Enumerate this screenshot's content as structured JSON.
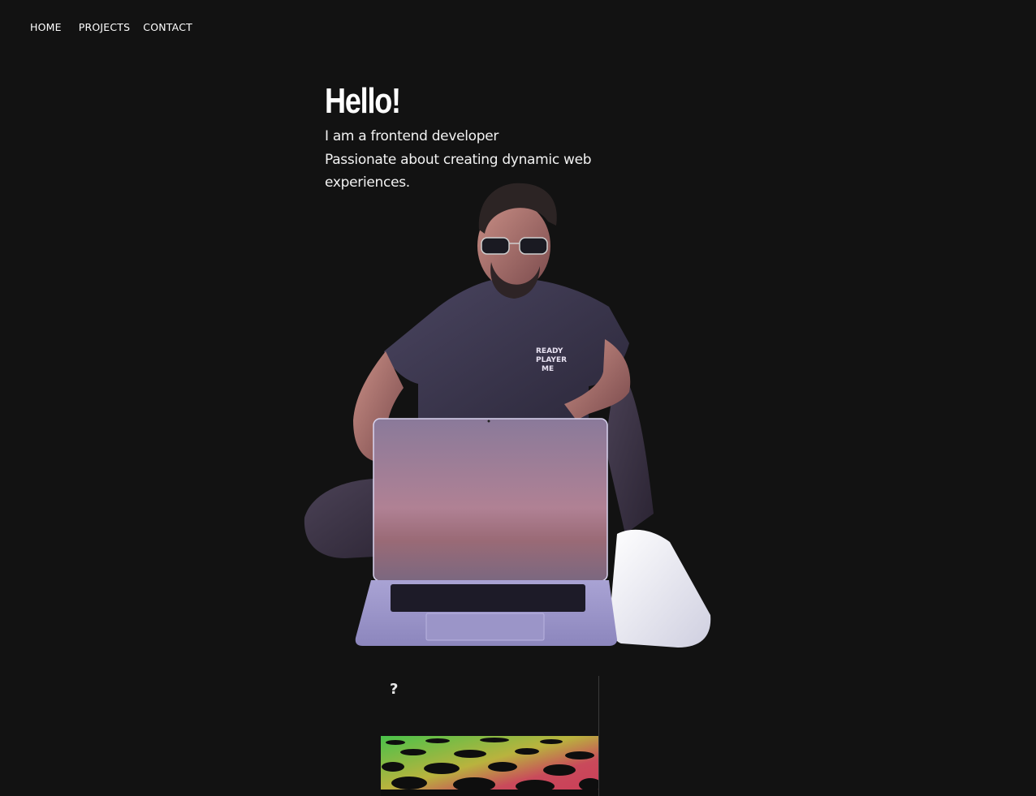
{
  "nav": {
    "items": [
      {
        "label": "HOME"
      },
      {
        "label": "PROJECTS"
      },
      {
        "label": "CONTACT"
      }
    ]
  },
  "hero": {
    "title": "Hello!",
    "line1": "I am a frontend developer",
    "line2": "Passionate about creating dynamic web experiences."
  },
  "avatar": {
    "shirt_text": [
      "READY",
      "PLAYER",
      "ME"
    ]
  },
  "widget": {
    "help_label": "?"
  },
  "colors": {
    "background": "#121212",
    "text": "#ffffff",
    "shirt": "#3a3548",
    "laptop": "#9f99c9"
  }
}
